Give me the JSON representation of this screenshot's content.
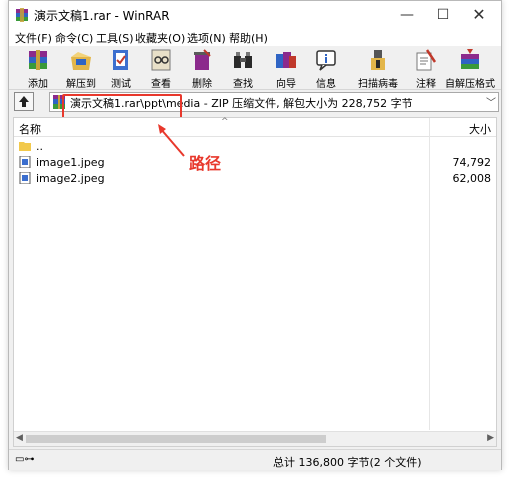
{
  "window": {
    "title": "演示文稿1.rar - WinRAR",
    "minimize_glyph": "—",
    "maximize_glyph": "☐",
    "close_glyph": "✕"
  },
  "menu": [
    "文件(F)",
    "命令(C)",
    "工具(S)",
    "收藏夹(O)",
    "选项(N)",
    "帮助(H)"
  ],
  "toolbar": [
    {
      "label": "添加",
      "icon": "add-archive-icon"
    },
    {
      "label": "解压到",
      "icon": "extract-to-icon"
    },
    {
      "label": "测试",
      "icon": "test-icon"
    },
    {
      "label": "查看",
      "icon": "view-icon"
    },
    {
      "label": "删除",
      "icon": "delete-icon"
    },
    {
      "label": "查找",
      "icon": "find-icon"
    },
    {
      "label": "向导",
      "icon": "wizard-icon"
    },
    {
      "label": "信息",
      "icon": "info-icon"
    },
    {
      "label": "扫描病毒",
      "icon": "virus-scan-icon"
    },
    {
      "label": "注释",
      "icon": "comment-icon"
    },
    {
      "label": "自解压格式",
      "icon": "sfx-icon"
    }
  ],
  "address": {
    "path": "演示文稿1.rar\\ppt\\media - ZIP 压缩文件, 解包大小为 228,752 字节"
  },
  "columns": {
    "name": "名称",
    "size": "大小"
  },
  "files": [
    {
      "name": "..",
      "size": "",
      "type": "folder"
    },
    {
      "name": "image1.jpeg",
      "size": "74,792",
      "type": "image"
    },
    {
      "name": "image2.jpeg",
      "size": "62,008",
      "type": "image"
    }
  ],
  "status": {
    "text": "总计 136,800 字节(2 个文件)"
  },
  "annotation": {
    "label": "路径",
    "color": "#e8382c"
  }
}
